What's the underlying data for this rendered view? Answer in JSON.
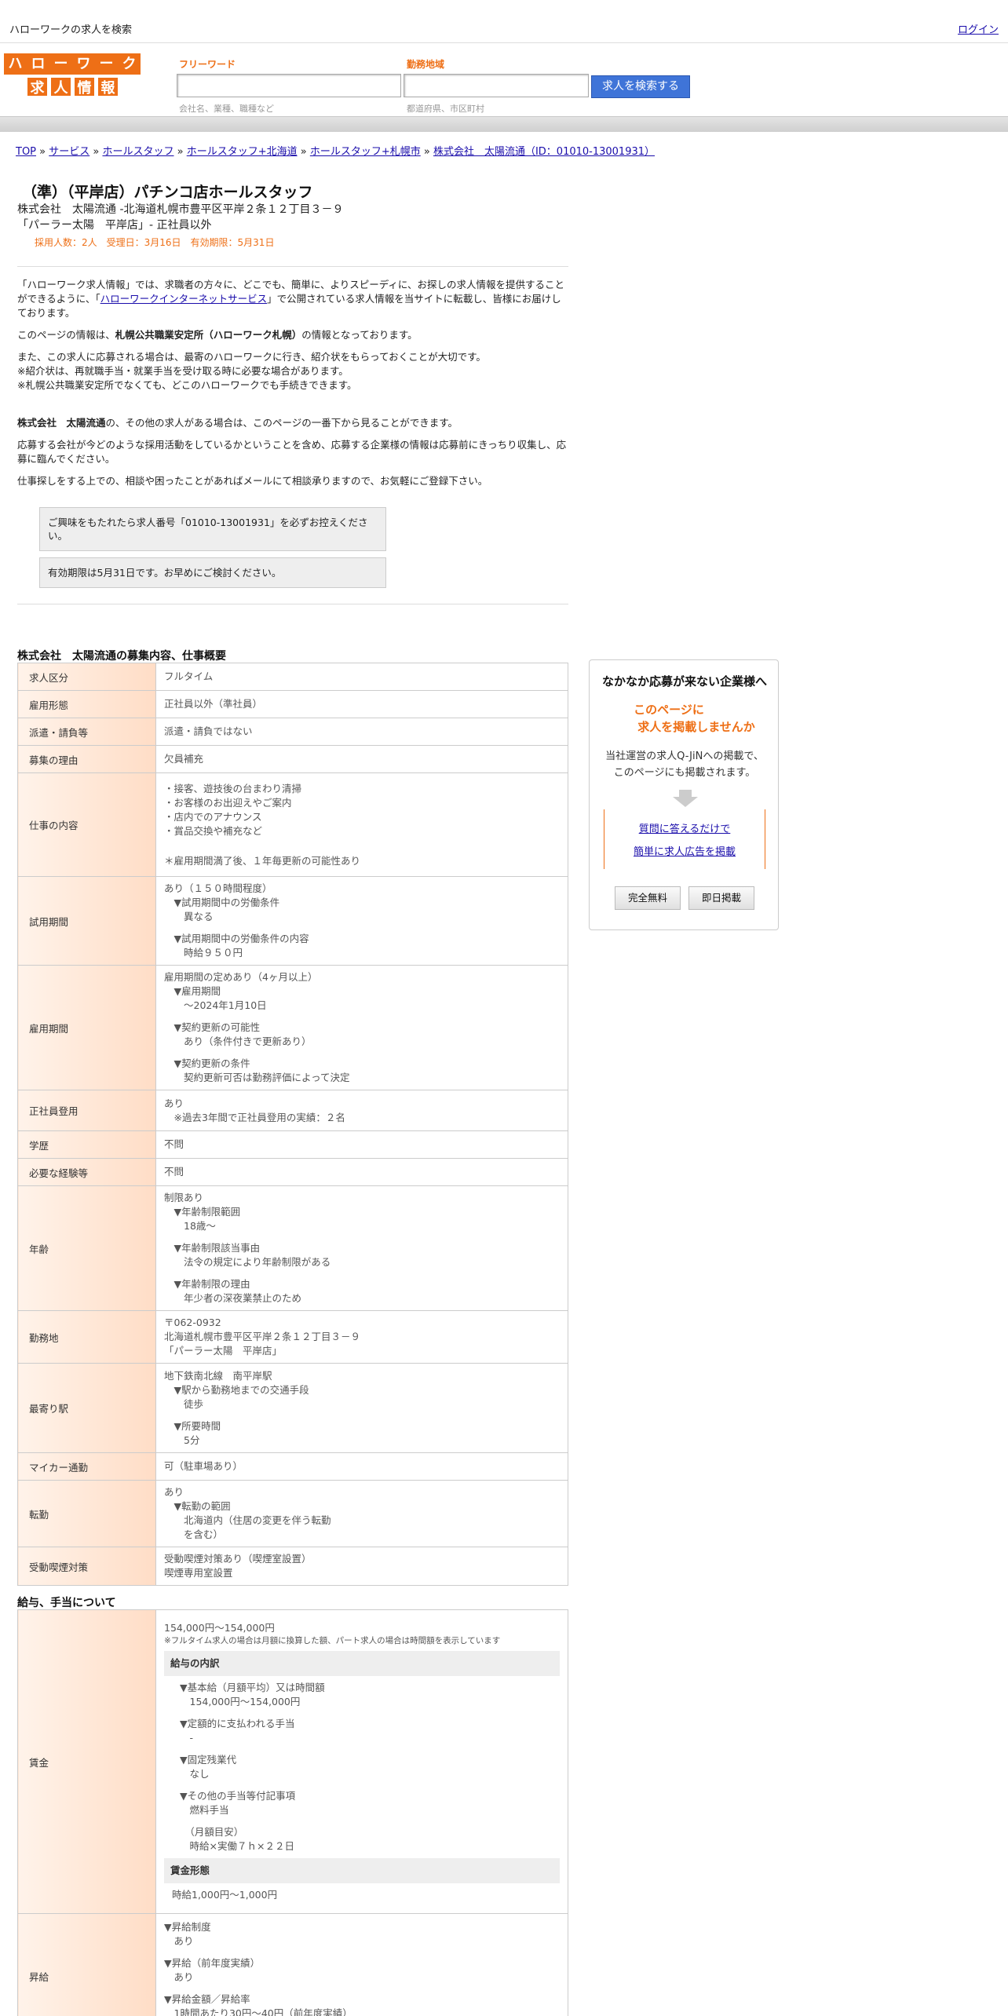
{
  "topbar": {
    "title": "ハローワークの求人を検索",
    "login": "ログイン"
  },
  "logo": {
    "row1": [
      "ハ",
      "ロ",
      "ー",
      "ワ",
      "ー",
      "ク"
    ],
    "row2": [
      "求",
      "人",
      "情",
      "報"
    ]
  },
  "search": {
    "keyword_label": "フリーワード",
    "keyword_hint": "会社名、業種、職種など",
    "area_label": "勤務地域",
    "area_hint": "都道府県、市区町村",
    "button": "求人を検索する"
  },
  "breadcrumb": [
    {
      "label": "TOP",
      "sep": " » "
    },
    {
      "label": "サービス",
      "sep": " » "
    },
    {
      "label": "ホールスタッフ",
      "sep": " » "
    },
    {
      "label": "ホールスタッフ+北海道",
      "sep": " » "
    },
    {
      "label": "ホールスタッフ+札幌市",
      "sep": " » "
    },
    {
      "label": "株式会社　太陽流通（ID：01010-13001931）",
      "sep": ""
    }
  ],
  "job": {
    "title": "（準）（平岸店）パチンコ店ホールスタッフ",
    "company_line": "株式会社　太陽流通 -北海道札幌市豊平区平岸２条１２丁目３－９",
    "store_line": "「パーラー太陽　平岸店」- 正社員以外",
    "meta": "採用人数：2人　受理日：3月16日　有効期限：5月31日"
  },
  "intro": {
    "p1a": "「ハローワーク求人情報」では、求職者の方々に、どこでも、簡単に、よりスピーディに、お探しの求人情報を提供することができるように、「",
    "p1link": "ハローワークインターネットサービス",
    "p1b": "」で公開されている求人情報を当サイトに転載し、皆様にお届けしております。",
    "p2a": "このページの情報は、",
    "p2b": "札幌公共職業安定所（ハローワーク札幌）",
    "p2c": "の情報となっております。",
    "p3": "また、この求人に応募される場合は、最寄のハローワークに行き、紹介状をもらっておくことが大切です。",
    "p4": "※紹介状は、再就職手当・就業手当を受け取る時に必要な場合があります。",
    "p5": "※札幌公共職業安定所でなくても、どこのハローワークでも手続きできます。",
    "p6a": "株式会社　太陽流通",
    "p6b": "の、その他の求人がある場合は、このページの一番下から見ることができます。",
    "p7": "応募する会社が今どのような採用活動をしているかということを含め、応募する企業様の情報は応募前にきっちり収集し、応募に臨んでください。",
    "p8": "仕事探しをする上での、相談や困ったことがあればメールにて相談承りますので、お気軽にご登録下さい。",
    "box1": "ご興味をもたれたら求人番号「01010-13001931」を必ずお控えください。",
    "box2": "有効期限は5月31日です。お早めにご検討ください。"
  },
  "section1": "株式会社　太陽流通の募集内容、仕事概要",
  "rows": [
    {
      "k": "求人区分",
      "v": [
        "フルタイム"
      ]
    },
    {
      "k": "雇用形態",
      "v": [
        "正社員以外（準社員）"
      ]
    },
    {
      "k": "派遣・請負等",
      "v": [
        "派遣・請負ではない"
      ]
    },
    {
      "k": "募集の理由",
      "v": [
        "欠員補充"
      ]
    },
    {
      "k": "仕事の内容",
      "v": [
        "・接客、遊技後の台まわり清掃",
        "・お客様のお出迎えやご案内",
        "・店内でのアナウンス",
        "・賞品交換や補充など",
        "",
        "",
        "＊雇用期間満了後、１年毎更新の可能性あり"
      ]
    },
    {
      "k": "試用期間",
      "v": [
        "あり（１５０時間程度）",
        "　▼試用期間中の労働条件",
        "　　異なる",
        "",
        "　▼試用期間中の労働条件の内容",
        "　　時給９５０円"
      ]
    },
    {
      "k": "雇用期間",
      "v": [
        "雇用期間の定めあり（4ヶ月以上）",
        "　▼雇用期間",
        "　　〜2024年1月10日",
        "",
        "　▼契約更新の可能性",
        "　　あり（条件付きで更新あり）",
        "",
        "　▼契約更新の条件",
        "　　契約更新可否は勤務評価によって決定"
      ]
    },
    {
      "k": "正社員登用",
      "v": [
        "あり",
        "　※過去3年間で正社員登用の実績：２名"
      ]
    },
    {
      "k": "学歴",
      "v": [
        "不問"
      ]
    },
    {
      "k": "必要な経験等",
      "v": [
        "不問"
      ]
    },
    {
      "k": "年齢",
      "v": [
        "制限あり",
        "　▼年齢制限範囲",
        "　　18歳〜",
        "",
        "　▼年齢制限該当事由",
        "　　法令の規定により年齢制限がある",
        "",
        "　▼年齢制限の理由",
        "　　年少者の深夜業禁止のため"
      ]
    },
    {
      "k": "勤務地",
      "v": [
        "〒062-0932",
        "北海道札幌市豊平区平岸２条１２丁目３－９",
        "「パーラー太陽　平岸店」"
      ]
    },
    {
      "k": "最寄り駅",
      "v": [
        "地下鉄南北線　南平岸駅",
        "　▼駅から勤務地までの交通手段",
        "　　徒歩",
        "",
        "　▼所要時間",
        "　　5分"
      ]
    },
    {
      "k": "マイカー通勤",
      "v": [
        "可（駐車場あり）"
      ]
    },
    {
      "k": "転勤",
      "v": [
        "あり",
        "　▼転勤の範囲",
        "　　北海道内（住居の変更を伴う転勤",
        "　　を含む）"
      ]
    },
    {
      "k": "受動喫煙対策",
      "v": [
        "受動喫煙対策あり（喫煙室設置）",
        "喫煙専用室設置"
      ]
    }
  ],
  "section2": "給与、手当について",
  "wage": {
    "k": "賃金",
    "range": "154,000円〜154,000円",
    "note": "※フルタイム求人の場合は月額に換算した額、パート求人の場合は時間額を表示しています",
    "breakdown_title": "給与の内訳",
    "lines": [
      "▼基本給（月額平均）又は時間額",
      "　154,000円〜154,000円",
      "",
      "▼定額的に支払われる手当",
      "　-",
      "",
      "▼固定残業代",
      "　なし",
      "",
      "▼その他の手当等付記事項",
      "　燃料手当",
      "",
      "　（月額目安）",
      "　時給×実働７ｈ×２２日"
    ],
    "form_title": "賃金形態",
    "form_value": "時給1,000円〜1,000円"
  },
  "raise": {
    "k": "昇給",
    "v": [
      "▼昇給制度",
      "　あり",
      "",
      "▼昇給（前年度実績）",
      "　あり",
      "",
      "▼昇給金額／昇給率",
      "　1時間あたり30円〜40円（前年度実績）"
    ]
  },
  "side": {
    "heading": "なかなか応募が来ない企業様へ",
    "offer1": "このページに",
    "offer2": "求人を掲載しませんか",
    "desc1": "当社運営の求人Q-JiNへの掲載で、",
    "desc2": "このページにも掲載されます。",
    "link1": "質問に答えるだけで",
    "link2": "簡単に求人広告を掲載",
    "btn1": "完全無料",
    "btn2": "即日掲載"
  },
  "colors": {
    "accent": "#ee6f16",
    "link": "#1a0dab",
    "button": "#3f74d8"
  }
}
